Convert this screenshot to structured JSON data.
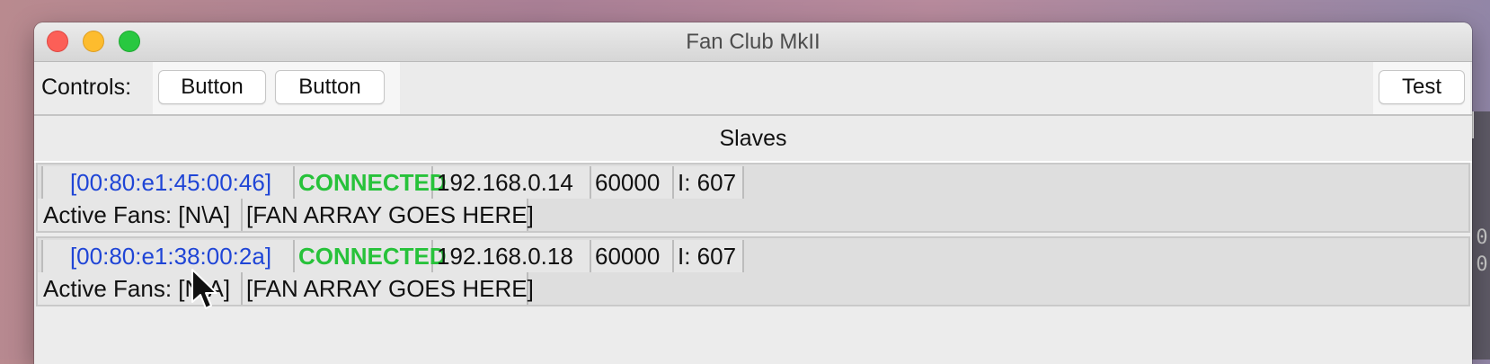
{
  "window": {
    "title": "Fan Club MkII"
  },
  "controls": {
    "label": "Controls:",
    "button1": "Button",
    "button2": "Button",
    "test": "Test"
  },
  "slaves": {
    "header": "Slaves",
    "items": [
      {
        "mac": "[00:80:e1:45:00:46]",
        "status": "CONNECTED",
        "ip": "192.168.0.14",
        "port": "60000",
        "index": "I: 607",
        "active_fans": "Active Fans: [N\\A]",
        "fan_array": "[FAN ARRAY GOES HERE]"
      },
      {
        "mac": "[00:80:e1:38:00:2a]",
        "status": "CONNECTED",
        "ip": "192.168.0.18",
        "port": "60000",
        "index": "I: 607",
        "active_fans": "Active Fans: [N\\A]",
        "fan_array": "[FAN ARRAY GOES HERE]"
      }
    ]
  },
  "background_terminal": {
    "digits": [
      "0",
      "0"
    ]
  },
  "colors": {
    "mac_blue": "#1f45d6",
    "connected_green": "#27c23a",
    "close": "#fc5f57",
    "minimize": "#fdbc2e",
    "maximize": "#28c840"
  }
}
